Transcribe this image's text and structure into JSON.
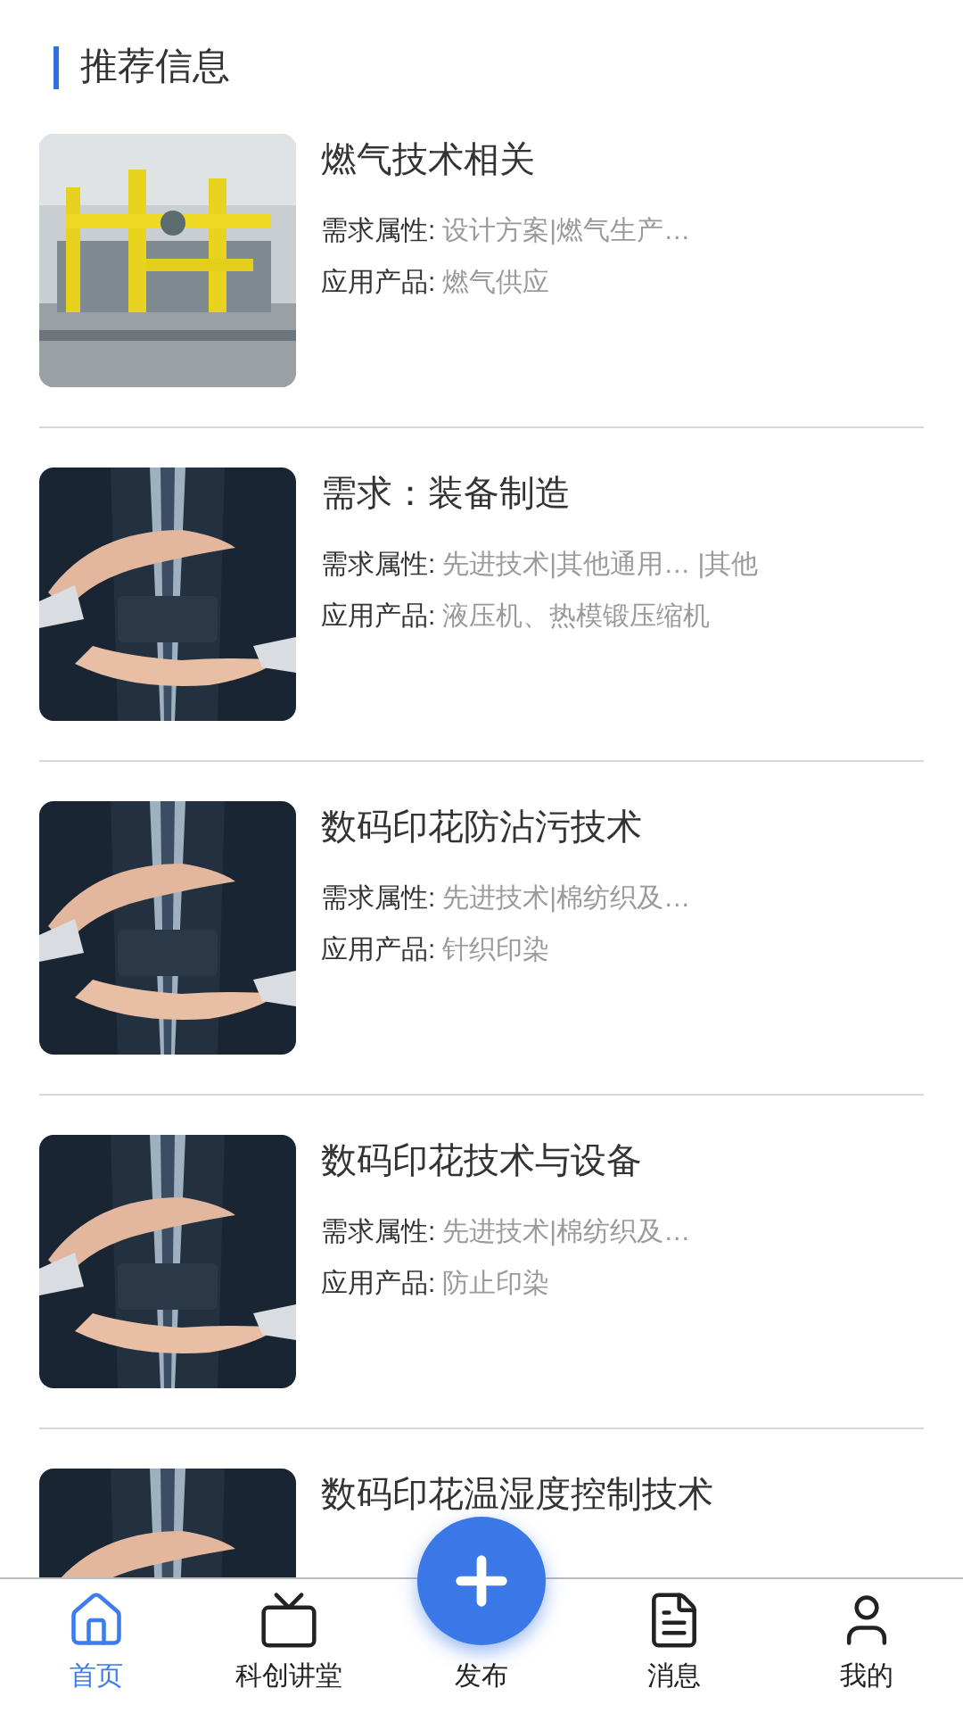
{
  "section_title": "推荐信息",
  "items": [
    {
      "title": "燃气技术相关",
      "fields": [
        {
          "label": "需求属性:",
          "value": "设计方案|燃气生产…"
        },
        {
          "label": "应用产品:",
          "value": "燃气供应"
        }
      ]
    },
    {
      "title": "需求：装备制造",
      "fields": [
        {
          "label": "需求属性:",
          "value": "先进技术|其他通用… |其他"
        },
        {
          "label": "应用产品:",
          "value": "液压机、热模锻压缩机"
        }
      ]
    },
    {
      "title": "数码印花防沾污技术",
      "fields": [
        {
          "label": "需求属性:",
          "value": "先进技术|棉纺织及…"
        },
        {
          "label": "应用产品:",
          "value": "针织印染"
        }
      ]
    },
    {
      "title": "数码印花技术与设备",
      "fields": [
        {
          "label": "需求属性:",
          "value": "先进技术|棉纺织及…"
        },
        {
          "label": "应用产品:",
          "value": "防止印染"
        }
      ]
    },
    {
      "title": "数码印花温湿度控制技术"
    }
  ],
  "nav": [
    {
      "label": "首页",
      "kind": "home",
      "selected": true
    },
    {
      "label": "科创讲堂",
      "kind": "tv",
      "selected": false
    },
    {
      "label": "发布",
      "kind": "publish",
      "selected": false
    },
    {
      "label": "消息",
      "kind": "message",
      "selected": false
    },
    {
      "label": "我的",
      "kind": "profile",
      "selected": false
    }
  ]
}
